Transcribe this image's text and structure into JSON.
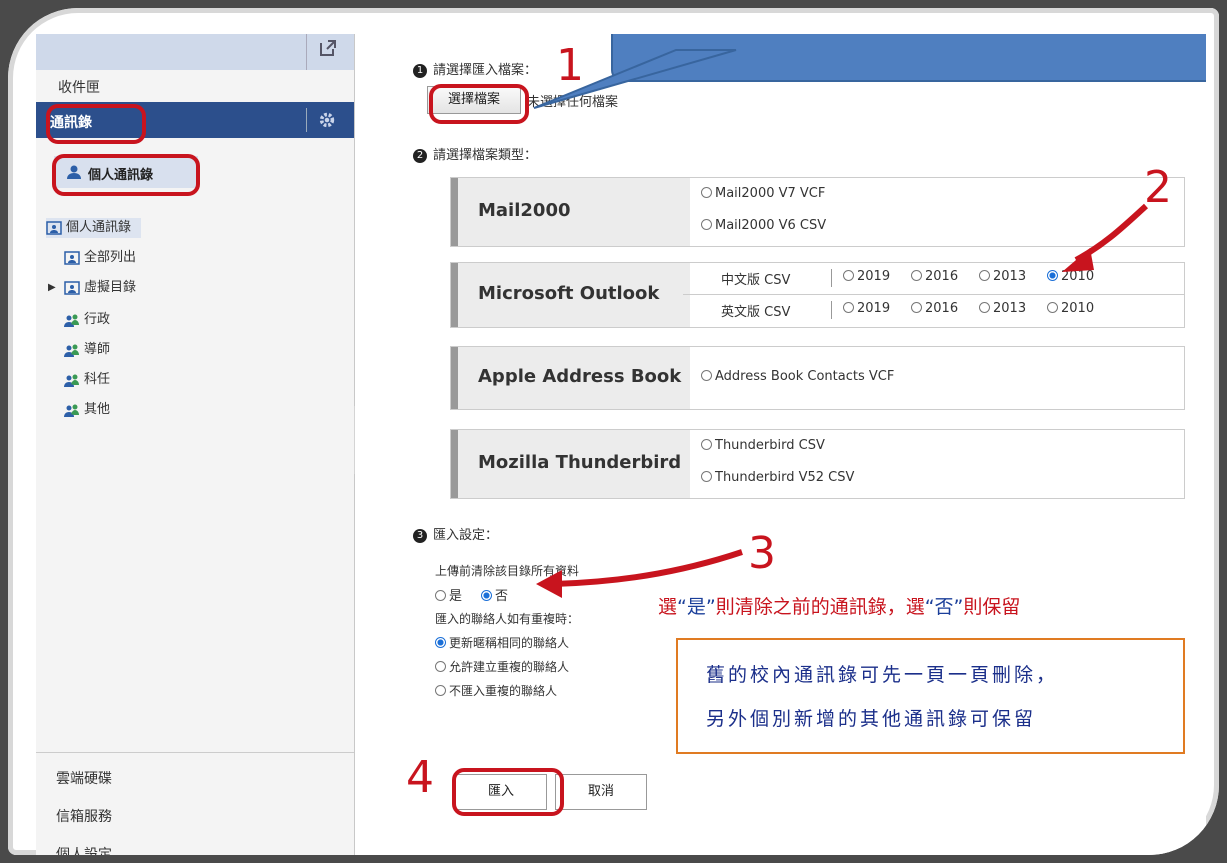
{
  "sidebar": {
    "inbox": "收件匣",
    "contacts": "通訊錄",
    "personal_pill": "個人通訊錄",
    "tree": [
      {
        "label": "個人通訊錄",
        "kind": "book",
        "selected": true
      },
      {
        "label": "全部列出",
        "kind": "book"
      },
      {
        "label": "虛擬目錄",
        "kind": "book",
        "expandable": true
      },
      {
        "label": "行政",
        "kind": "group"
      },
      {
        "label": "導師",
        "kind": "group"
      },
      {
        "label": "科任",
        "kind": "group"
      },
      {
        "label": "其他",
        "kind": "group"
      }
    ],
    "bottom": [
      "雲端硬碟",
      "信箱服務",
      "個人設定"
    ]
  },
  "main": {
    "step1": "請選擇匯入檔案：",
    "choose_file": "選擇檔案",
    "no_file": "未選擇任何檔案",
    "step2": "請選擇檔案類型：",
    "types": [
      {
        "name": "Mail2000",
        "options": [
          "Mail2000 V7 VCF",
          "Mail2000 V6 CSV"
        ]
      },
      {
        "name": "Microsoft Outlook",
        "rows": [
          {
            "label": "中文版 CSV",
            "years": [
              "2019",
              "2016",
              "2013",
              "2010"
            ],
            "selected": "2010"
          },
          {
            "label": "英文版 CSV",
            "years": [
              "2019",
              "2016",
              "2013",
              "2010"
            ],
            "selected": null
          }
        ]
      },
      {
        "name": "Apple Address Book",
        "options": [
          "Address Book Contacts VCF"
        ]
      },
      {
        "name": "Mozilla Thunderbird",
        "options": [
          "Thunderbird CSV",
          "Thunderbird V52 CSV"
        ]
      }
    ],
    "step3": "匯入設定：",
    "clear_label": "上傳前清除該目錄所有資料",
    "yes": "是",
    "no": "否",
    "clear_selected": "否",
    "dup_label": "匯入的聯絡人如有重複時：",
    "dup_options": [
      "更新暱稱相同的聯絡人",
      "允許建立重複的聯絡人",
      "不匯入重複的聯絡人"
    ],
    "dup_selected": 0,
    "import_button": "匯入",
    "cancel_button": "取消"
  },
  "annotations": {
    "num1": "1",
    "num2": "2",
    "num3": "3",
    "num4": "4",
    "note_pre": "選",
    "note_yes": "“是”",
    "note_mid": "則清除之前的通訊錄，選",
    "note_no": "“否”",
    "note_post": "則保留",
    "box_line1": "舊的校內通訊錄可先一頁一頁刪除，",
    "box_line2": "另外個別新增的其他通訊錄可保留"
  },
  "colors": {
    "sidebar_active": "#2c4f8c",
    "annotation_red": "#c8141e",
    "callout_blue": "#4f7fc0",
    "note_box_border": "#e07b22",
    "radio_on": "#1a6fd8"
  }
}
